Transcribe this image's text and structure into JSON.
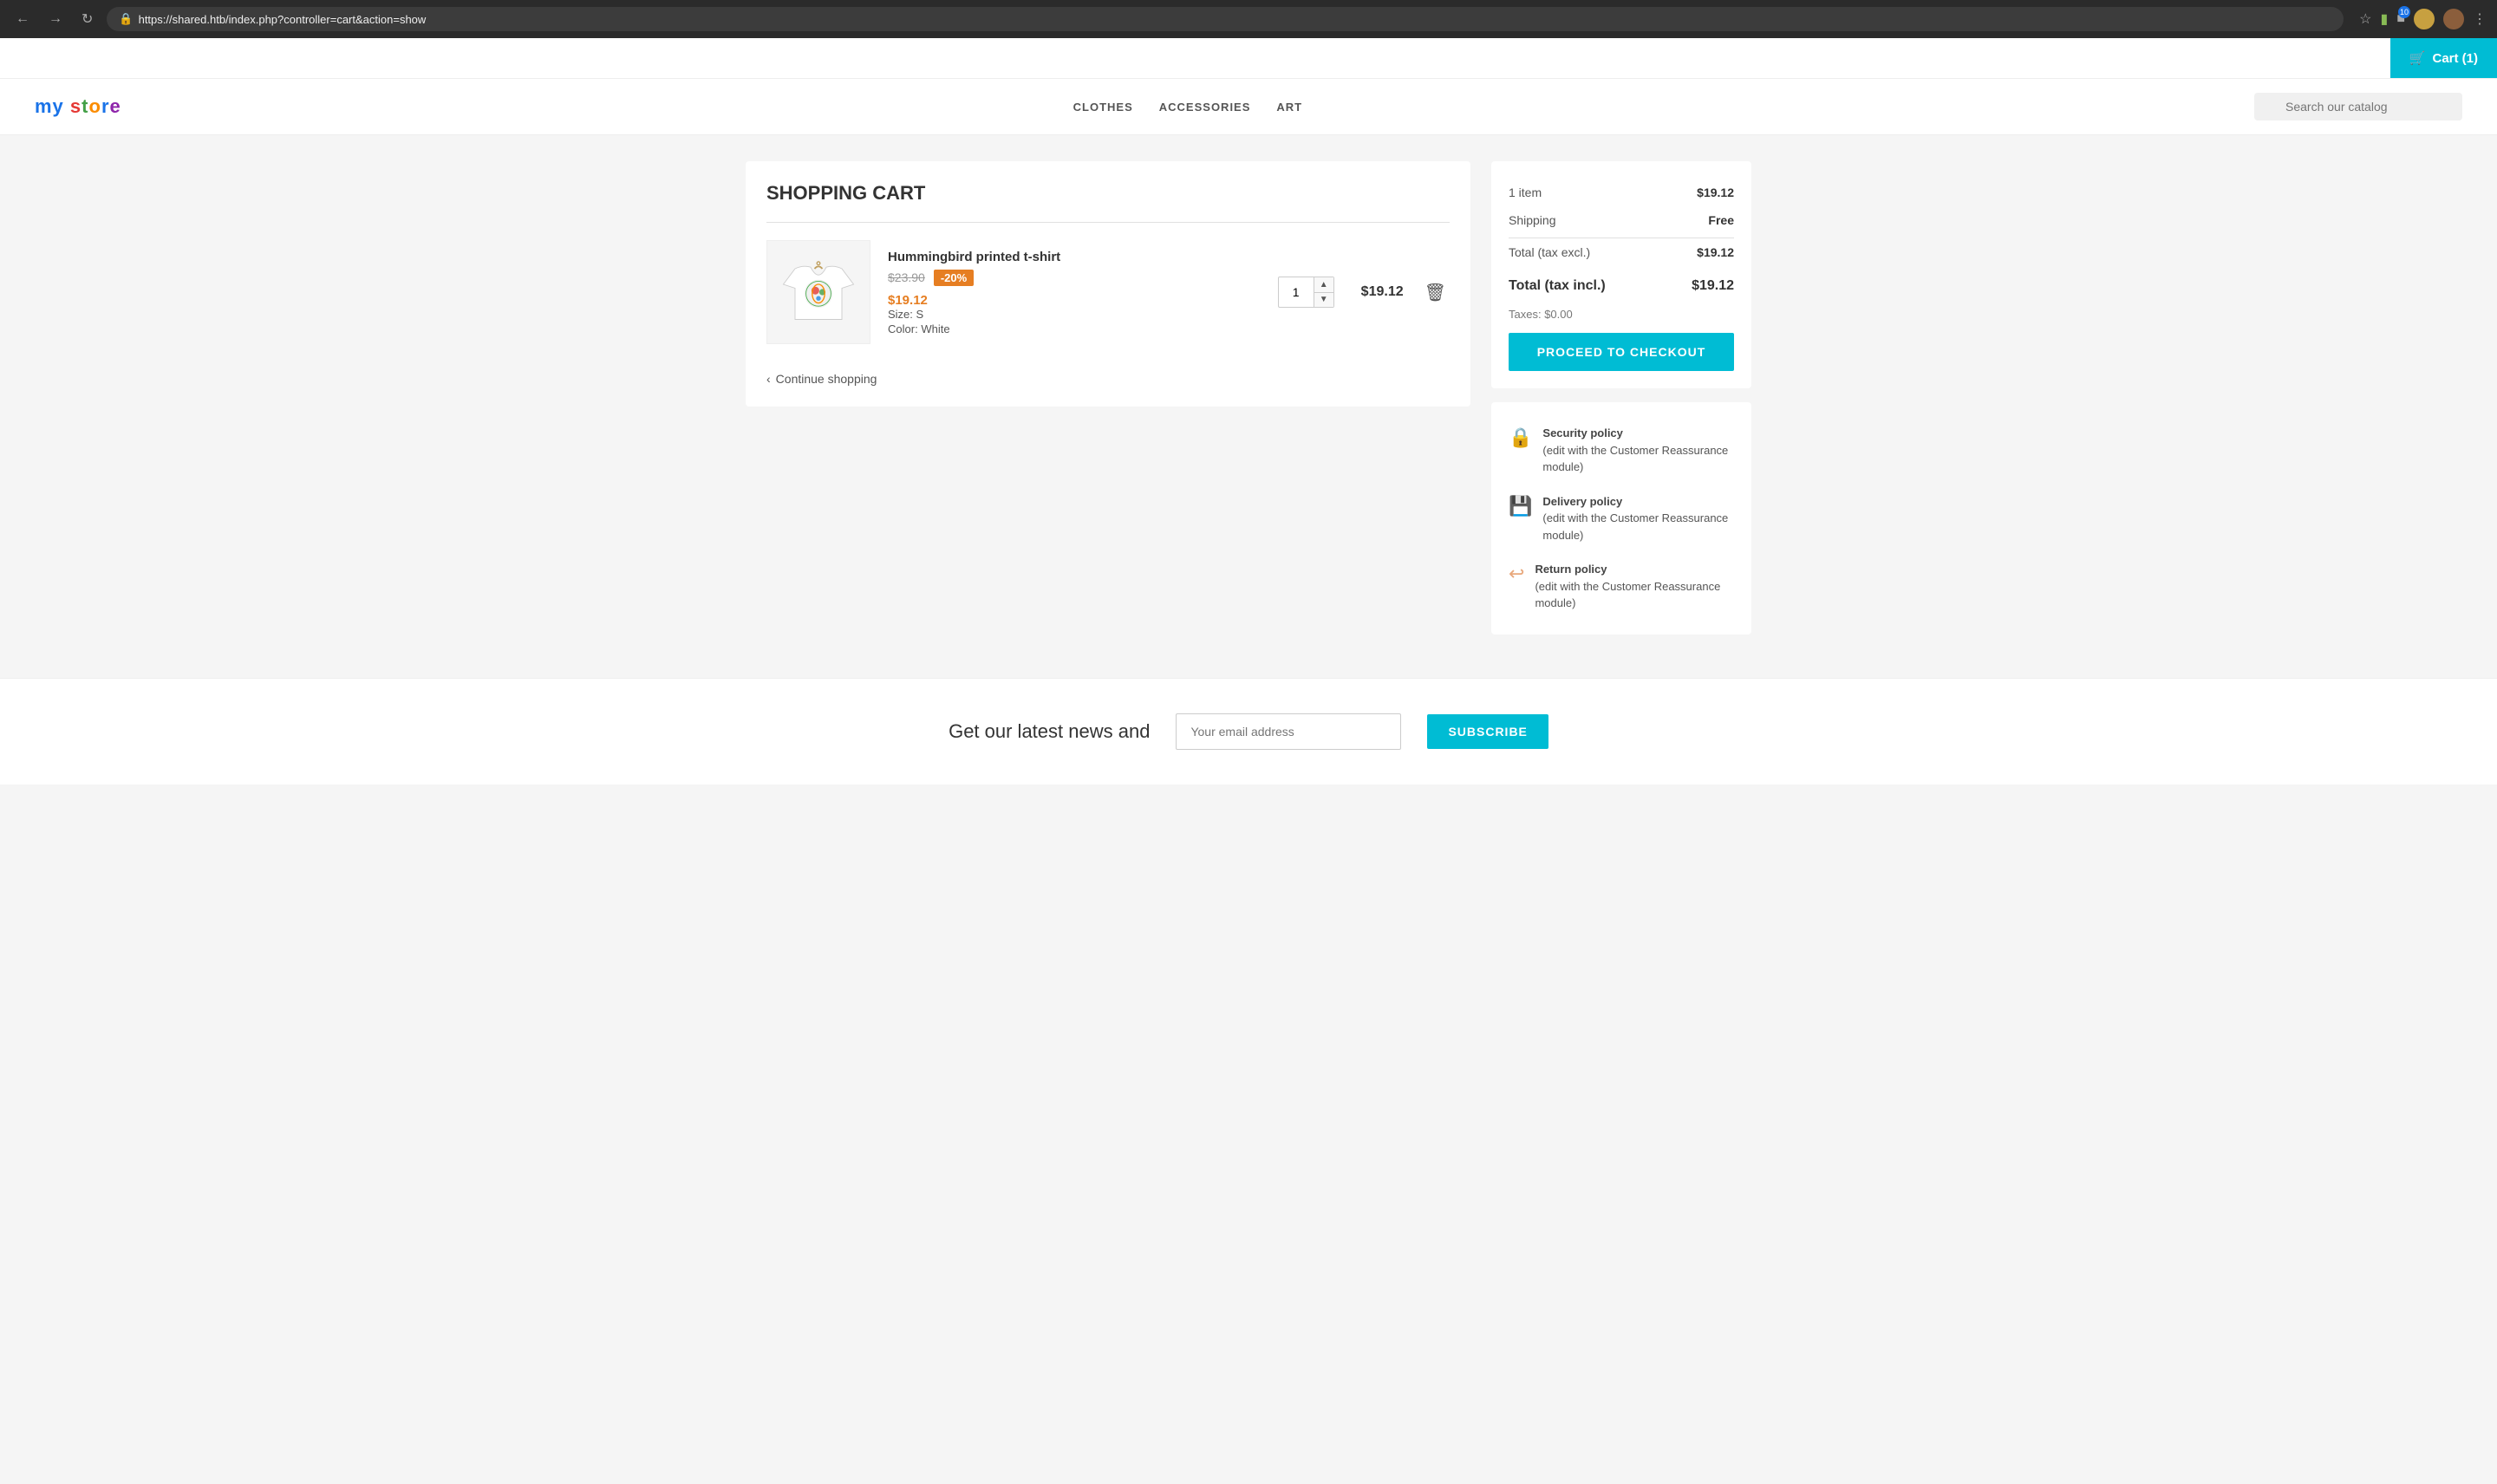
{
  "browser": {
    "url": "https://shared.htb/index.php?controller=cart&action=show",
    "back_label": "←",
    "forward_label": "→",
    "refresh_label": "↻",
    "badge_count": "10"
  },
  "cart_button": {
    "label": "Cart (1)",
    "icon": "🛒"
  },
  "nav": {
    "logo": "my store",
    "links": [
      "CLOTHES",
      "ACCESSORIES",
      "ART"
    ],
    "search_placeholder": "Search our catalog"
  },
  "cart": {
    "title": "SHOPPING CART",
    "item": {
      "name": "Hummingbird printed t-shirt",
      "price_original": "$23.90",
      "discount": "-20%",
      "price_current": "$19.12",
      "size_label": "Size:",
      "size_value": "S",
      "color_label": "Color:",
      "color_value": "White",
      "quantity": "1",
      "total": "$19.12"
    },
    "continue_label": "Continue shopping"
  },
  "summary": {
    "item_count_label": "1 item",
    "item_count_value": "$19.12",
    "shipping_label": "Shipping",
    "shipping_value": "Free",
    "total_excl_label": "Total (tax excl.)",
    "total_excl_value": "$19.12",
    "total_incl_label": "Total (tax incl.)",
    "total_incl_value": "$19.12",
    "taxes_label": "Taxes:",
    "taxes_value": "$0.00",
    "checkout_label": "PROCEED TO CHECKOUT"
  },
  "policies": [
    {
      "title": "Security policy",
      "desc": "(edit with the Customer Reassurance module)",
      "icon": "🔒"
    },
    {
      "title": "Delivery policy",
      "desc": "(edit with the Customer Reassurance module)",
      "icon": "💾"
    },
    {
      "title": "Return policy",
      "desc": "(edit with the Customer Reassurance module)",
      "icon": "↩"
    }
  ],
  "newsletter": {
    "title": "Get our latest news and",
    "input_placeholder": "Your email address",
    "button_label": "SUBSCRIBE"
  }
}
